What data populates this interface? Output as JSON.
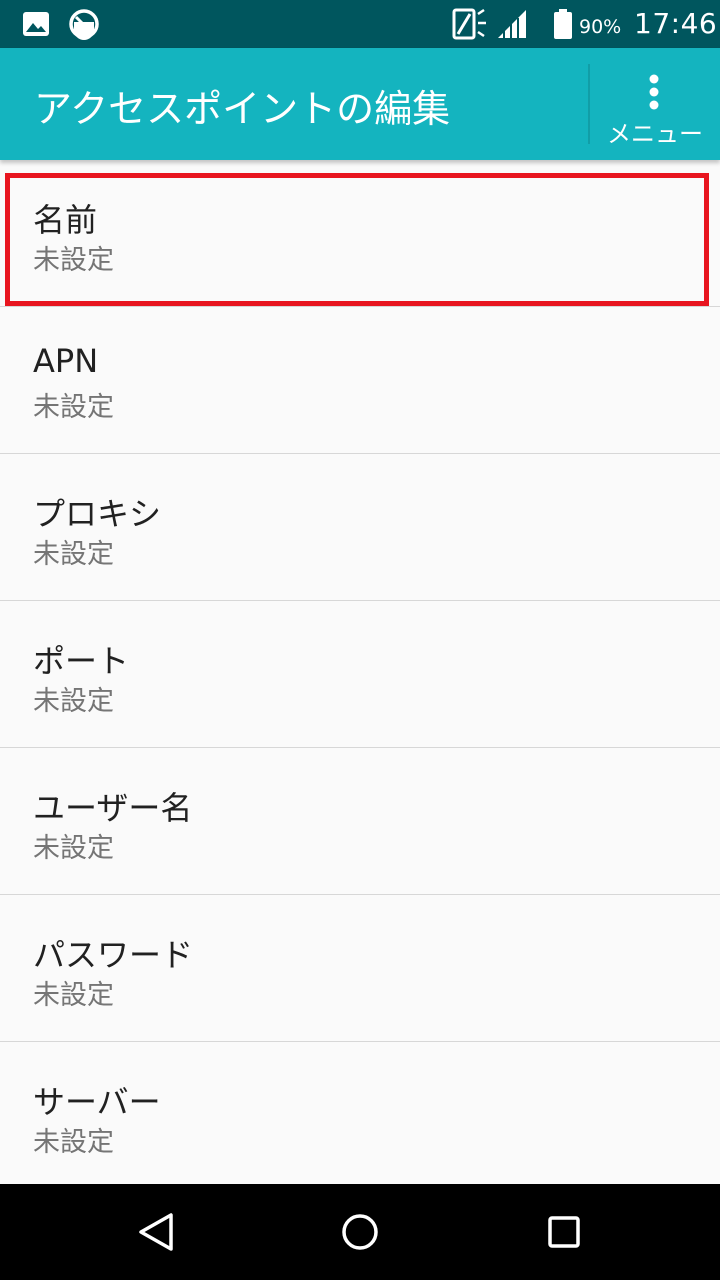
{
  "status_bar": {
    "battery_percent": "90%",
    "time": "17:46",
    "icons": [
      "image-icon",
      "speedometer-icon",
      "vibrate-icon",
      "signal-icon",
      "battery-icon"
    ]
  },
  "app_bar": {
    "title": "アクセスポイントの編集",
    "menu_label": "メニュー",
    "menu_icon": "more-vert-icon",
    "background_color": "#14b4bf"
  },
  "settings": {
    "items": [
      {
        "title": "名前",
        "summary": "未設定"
      },
      {
        "title": "APN",
        "summary": "未設定"
      },
      {
        "title": "プロキシ",
        "summary": "未設定"
      },
      {
        "title": "ポート",
        "summary": "未設定"
      },
      {
        "title": "ユーザー名",
        "summary": "未設定"
      },
      {
        "title": "パスワード",
        "summary": "未設定"
      },
      {
        "title": "サーバー",
        "summary": "未設定"
      }
    ]
  },
  "highlight_color": "#e8151f",
  "nav_bar": {
    "icons": [
      "back-icon",
      "home-icon",
      "recents-icon"
    ]
  }
}
